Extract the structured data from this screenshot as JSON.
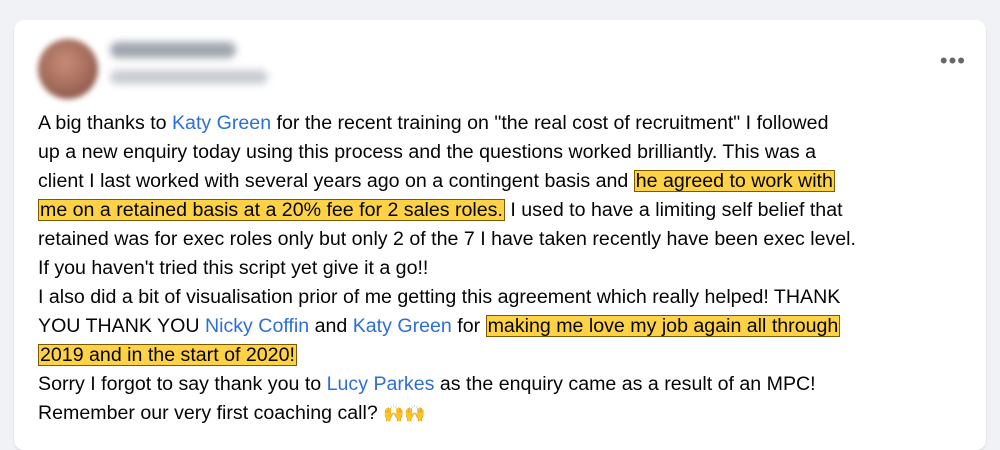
{
  "post": {
    "more_icon": "more-horizontal-icon",
    "highlight_color": "#fdd247",
    "mention_color": "#2d6fd4",
    "lines": [
      [
        "A big thanks to ",
        "Katy Green",
        " for the recent training on \"the real cost of recruitment\" I followed"
      ],
      [
        "up a new enquiry today using this process and the questions worked brilliantly. This was a"
      ],
      [
        "client I last worked with several years ago on a contingent basis and ",
        "he agreed to work with"
      ],
      [
        "me on a retained basis at a 20% fee for 2 sales roles.",
        " I used to have a limiting self belief that"
      ],
      [
        "retained was for exec roles only but only 2  of the 7 I have taken recently have been exec level."
      ],
      [
        "If you haven't tried this script yet give it a go!!"
      ],
      [
        "I also did a bit of visualisation prior of me getting this agreement which really helped! THANK"
      ],
      [
        "YOU THANK YOU ",
        "Nicky Coffin",
        " and ",
        "Katy Green",
        " for ",
        "making me love my job again all through"
      ],
      [
        "2019 and in the start of 2020!"
      ],
      [
        "Sorry I forgot to say thank you to ",
        "Lucy Parkes",
        " as the enquiry came as a result of an MPC!"
      ],
      [
        "Remember our very first coaching call? ",
        "🙌🙌"
      ]
    ]
  }
}
